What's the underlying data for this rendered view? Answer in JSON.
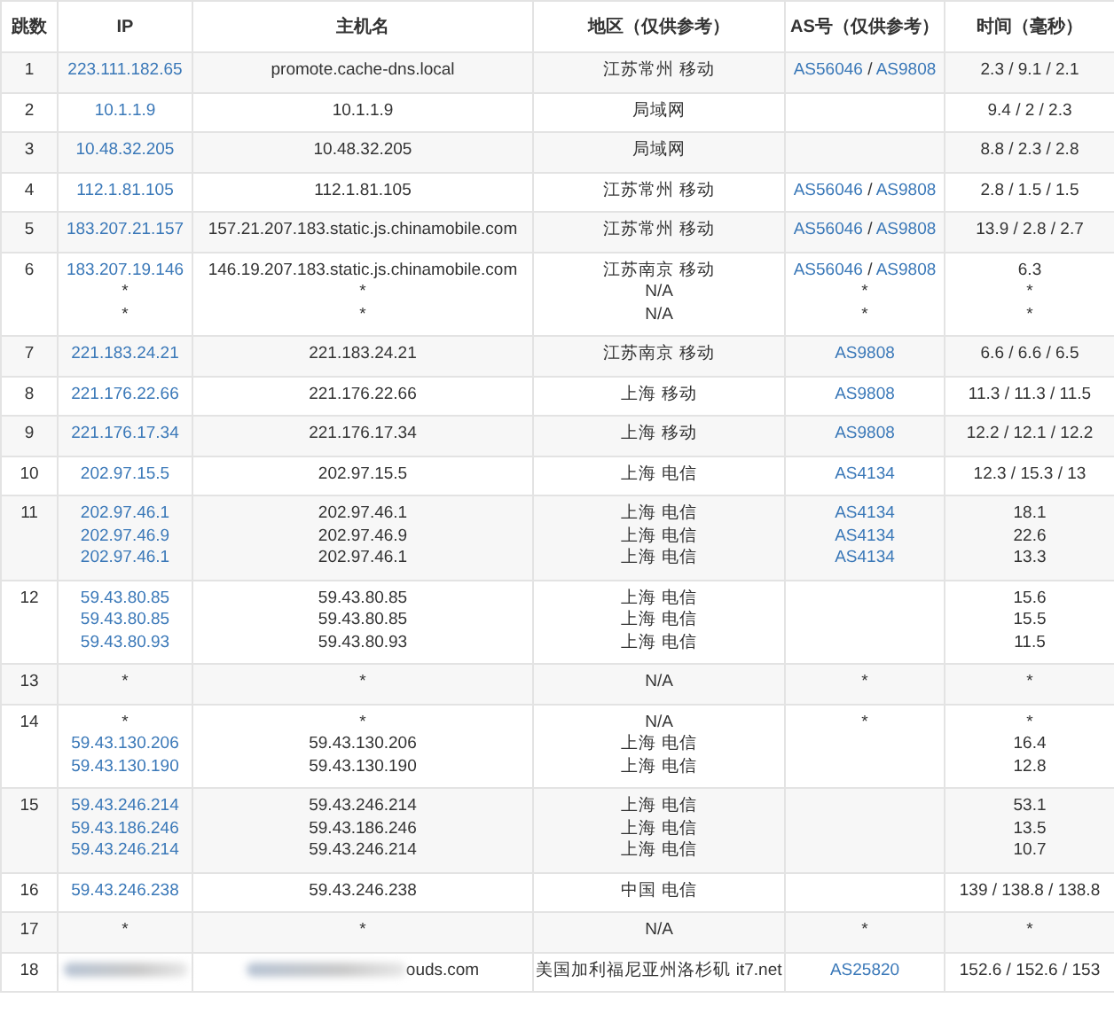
{
  "table": {
    "columns": [
      "跳数",
      "IP",
      "主机名",
      "地区（仅供参考）",
      "AS号（仅供参考）",
      "时间（毫秒）"
    ],
    "rows": [
      {
        "hop": "1",
        "ip": [
          [
            {
              "text": "223.111.182.65",
              "kind": "link"
            }
          ]
        ],
        "host": [
          "promote.cache-dns.local"
        ],
        "region": [
          "江苏常州 移动"
        ],
        "as": [
          [
            {
              "text": "AS56046",
              "kind": "link"
            },
            {
              "text": " / ",
              "kind": "plain"
            },
            {
              "text": "AS9808",
              "kind": "link"
            }
          ]
        ],
        "time": [
          "2.3 / 9.1 / 2.1"
        ]
      },
      {
        "hop": "2",
        "ip": [
          [
            {
              "text": "10.1.1.9",
              "kind": "link"
            }
          ]
        ],
        "host": [
          "10.1.1.9"
        ],
        "region": [
          "局域网"
        ],
        "as": [],
        "time": [
          "9.4 / 2 / 2.3"
        ]
      },
      {
        "hop": "3",
        "ip": [
          [
            {
              "text": "10.48.32.205",
              "kind": "link"
            }
          ]
        ],
        "host": [
          "10.48.32.205"
        ],
        "region": [
          "局域网"
        ],
        "as": [],
        "time": [
          "8.8 / 2.3 / 2.8"
        ]
      },
      {
        "hop": "4",
        "ip": [
          [
            {
              "text": "112.1.81.105",
              "kind": "link"
            }
          ]
        ],
        "host": [
          "112.1.81.105"
        ],
        "region": [
          "江苏常州 移动"
        ],
        "as": [
          [
            {
              "text": "AS56046",
              "kind": "link"
            },
            {
              "text": " / ",
              "kind": "plain"
            },
            {
              "text": "AS9808",
              "kind": "link"
            }
          ]
        ],
        "time": [
          "2.8 / 1.5 / 1.5"
        ]
      },
      {
        "hop": "5",
        "ip": [
          [
            {
              "text": "183.207.21.157",
              "kind": "link"
            }
          ]
        ],
        "host": [
          "157.21.207.183.static.js.chinamobile.com"
        ],
        "region": [
          "江苏常州 移动"
        ],
        "as": [
          [
            {
              "text": "AS56046",
              "kind": "link"
            },
            {
              "text": " / ",
              "kind": "plain"
            },
            {
              "text": "AS9808",
              "kind": "link"
            }
          ]
        ],
        "time": [
          "13.9 / 2.8 / 2.7"
        ]
      },
      {
        "hop": "6",
        "ip": [
          [
            {
              "text": "183.207.19.146",
              "kind": "link"
            }
          ],
          "*",
          "*"
        ],
        "host": [
          "146.19.207.183.static.js.chinamobile.com",
          "*",
          "*"
        ],
        "region": [
          "江苏南京 移动",
          "N/A",
          "N/A"
        ],
        "as": [
          [
            {
              "text": "AS56046",
              "kind": "link"
            },
            {
              "text": " / ",
              "kind": "plain"
            },
            {
              "text": "AS9808",
              "kind": "link"
            }
          ],
          "*",
          "*"
        ],
        "time": [
          "6.3",
          "*",
          "*"
        ]
      },
      {
        "hop": "7",
        "ip": [
          [
            {
              "text": "221.183.24.21",
              "kind": "link"
            }
          ]
        ],
        "host": [
          "221.183.24.21"
        ],
        "region": [
          "江苏南京 移动"
        ],
        "as": [
          [
            {
              "text": "AS9808",
              "kind": "link"
            }
          ]
        ],
        "time": [
          "6.6 / 6.6 / 6.5"
        ]
      },
      {
        "hop": "8",
        "ip": [
          [
            {
              "text": "221.176.22.66",
              "kind": "link"
            }
          ]
        ],
        "host": [
          "221.176.22.66"
        ],
        "region": [
          "上海 移动"
        ],
        "as": [
          [
            {
              "text": "AS9808",
              "kind": "link"
            }
          ]
        ],
        "time": [
          "11.3 / 11.3 / 11.5"
        ]
      },
      {
        "hop": "9",
        "ip": [
          [
            {
              "text": "221.176.17.34",
              "kind": "link"
            }
          ]
        ],
        "host": [
          "221.176.17.34"
        ],
        "region": [
          "上海 移动"
        ],
        "as": [
          [
            {
              "text": "AS9808",
              "kind": "link"
            }
          ]
        ],
        "time": [
          "12.2 / 12.1 / 12.2"
        ]
      },
      {
        "hop": "10",
        "ip": [
          [
            {
              "text": "202.97.15.5",
              "kind": "link"
            }
          ]
        ],
        "host": [
          "202.97.15.5"
        ],
        "region": [
          "上海 电信"
        ],
        "as": [
          [
            {
              "text": "AS4134",
              "kind": "link"
            }
          ]
        ],
        "time": [
          "12.3 / 15.3 / 13"
        ]
      },
      {
        "hop": "11",
        "ip": [
          [
            {
              "text": "202.97.46.1",
              "kind": "link"
            }
          ],
          [
            {
              "text": "202.97.46.9",
              "kind": "link"
            }
          ],
          [
            {
              "text": "202.97.46.1",
              "kind": "link"
            }
          ]
        ],
        "host": [
          "202.97.46.1",
          "202.97.46.9",
          "202.97.46.1"
        ],
        "region": [
          "上海 电信",
          "上海 电信",
          "上海 电信"
        ],
        "as": [
          [
            {
              "text": "AS4134",
              "kind": "link"
            }
          ],
          [
            {
              "text": "AS4134",
              "kind": "link"
            }
          ],
          [
            {
              "text": "AS4134",
              "kind": "link"
            }
          ]
        ],
        "time": [
          "18.1",
          "22.6",
          "13.3"
        ]
      },
      {
        "hop": "12",
        "ip": [
          [
            {
              "text": "59.43.80.85",
              "kind": "link"
            }
          ],
          [
            {
              "text": "59.43.80.85",
              "kind": "link"
            }
          ],
          [
            {
              "text": "59.43.80.93",
              "kind": "link"
            }
          ]
        ],
        "host": [
          "59.43.80.85",
          "59.43.80.85",
          "59.43.80.93"
        ],
        "region": [
          "上海 电信",
          "上海 电信",
          "上海 电信"
        ],
        "as": [],
        "time": [
          "15.6",
          "15.5",
          "11.5"
        ]
      },
      {
        "hop": "13",
        "ip": [
          "*"
        ],
        "host": [
          "*"
        ],
        "region": [
          "N/A"
        ],
        "as": [
          "*"
        ],
        "time": [
          "*"
        ]
      },
      {
        "hop": "14",
        "ip": [
          "*",
          [
            {
              "text": "59.43.130.206",
              "kind": "link"
            }
          ],
          [
            {
              "text": "59.43.130.190",
              "kind": "link"
            }
          ]
        ],
        "host": [
          "*",
          "59.43.130.206",
          "59.43.130.190"
        ],
        "region": [
          "N/A",
          "上海 电信",
          "上海 电信"
        ],
        "as": [
          "*"
        ],
        "time": [
          "*",
          "16.4",
          "12.8"
        ]
      },
      {
        "hop": "15",
        "ip": [
          [
            {
              "text": "59.43.246.214",
              "kind": "link"
            }
          ],
          [
            {
              "text": "59.43.186.246",
              "kind": "link"
            }
          ],
          [
            {
              "text": "59.43.246.214",
              "kind": "link"
            }
          ]
        ],
        "host": [
          "59.43.246.214",
          "59.43.186.246",
          "59.43.246.214"
        ],
        "region": [
          "上海 电信",
          "上海 电信",
          "上海 电信"
        ],
        "as": [],
        "time": [
          "53.1",
          "13.5",
          "10.7"
        ]
      },
      {
        "hop": "16",
        "ip": [
          [
            {
              "text": "59.43.246.238",
              "kind": "link"
            }
          ]
        ],
        "host": [
          "59.43.246.238"
        ],
        "region": [
          "中国 电信"
        ],
        "as": [],
        "time": [
          "139 / 138.8 / 138.8"
        ]
      },
      {
        "hop": "17",
        "ip": [
          "*"
        ],
        "host": [
          "*"
        ],
        "region": [
          "N/A"
        ],
        "as": [
          "*"
        ],
        "time": [
          "*"
        ]
      },
      {
        "hop": "18",
        "ip": [
          [
            {
              "kind": "blurred"
            }
          ]
        ],
        "host": [
          [
            {
              "kind": "blurred"
            },
            {
              "text": "ouds.com",
              "kind": "plain"
            }
          ]
        ],
        "region": [
          "美国加利福尼亚州洛杉矶 it7.net"
        ],
        "as": [
          [
            {
              "text": "AS25820",
              "kind": "link"
            }
          ]
        ],
        "time": [
          "152.6 / 152.6 / 153"
        ]
      }
    ]
  }
}
